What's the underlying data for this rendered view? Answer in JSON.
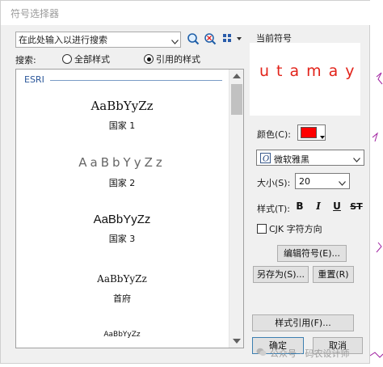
{
  "window": {
    "title": "符号选择器"
  },
  "search": {
    "placeholder": "在此处输入以进行搜索"
  },
  "search_scope": {
    "label": "搜索:",
    "options": [
      {
        "label": "全部样式",
        "selected": false
      },
      {
        "label": "引用的样式",
        "selected": true
      }
    ]
  },
  "symbol_list": {
    "group": "ESRI",
    "items": [
      {
        "sample": "AaBbYyZz",
        "name": "国家 1"
      },
      {
        "sample": "AaBbYyZz",
        "name": "国家 2"
      },
      {
        "sample": "AaBbYyZz",
        "name": "国家 3"
      },
      {
        "sample": "AaBbYyZz",
        "name": "首府"
      },
      {
        "sample": "AaBbYyZz",
        "name": ""
      }
    ]
  },
  "current_symbol": {
    "label": "当前符号",
    "preview_text": "utamay",
    "preview_color": "#e2231a"
  },
  "properties": {
    "color_label": "颜色(C):",
    "color_value": "#ff0000",
    "font": "微软雅黑",
    "size_label": "大小(S):",
    "size": "20",
    "style_label": "样式(T):",
    "style_buttons": {
      "bold": "B",
      "italic": "I",
      "underline": "U",
      "strikethrough": "ST"
    },
    "cjk_label": "CJK 字符方向",
    "cjk_checked": false
  },
  "buttons": {
    "edit_symbol": "编辑符号(E)...",
    "save_as": "另存为(S)...",
    "reset": "重置(R)",
    "style_references": "样式引用(F)...",
    "ok": "确定",
    "cancel": "取消"
  },
  "watermark": "公众号 · 码农设计师"
}
